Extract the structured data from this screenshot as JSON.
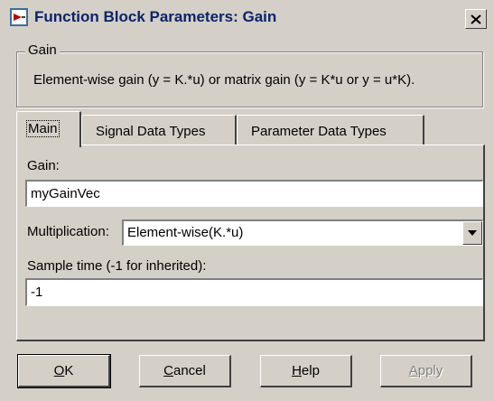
{
  "window": {
    "title": "Function Block Parameters: Gain",
    "close_glyph": "✕"
  },
  "group": {
    "legend": "Gain",
    "description": "Element-wise gain (y = K.*u) or matrix gain (y = K*u or y = u*K)."
  },
  "tabs": [
    {
      "label": "Main",
      "active": true
    },
    {
      "label": "Signal Data Types",
      "active": false
    },
    {
      "label": "Parameter Data Types",
      "active": false
    }
  ],
  "main": {
    "gain_label": "Gain:",
    "gain_value": "myGainVec",
    "multiplication_label": "Multiplication:",
    "multiplication_value": "Element-wise(K.*u)",
    "sample_time_label": "Sample time (-1 for inherited):",
    "sample_time_value": "-1"
  },
  "buttons": {
    "ok_accel": "O",
    "ok_rest": "K",
    "cancel_accel": "C",
    "cancel_rest": "ancel",
    "help_accel": "H",
    "help_rest": "elp",
    "apply_accel": "A",
    "apply_rest": "pply"
  },
  "icons": {
    "app": "simulink-block-icon",
    "close": "close-icon",
    "dropdown": "chevron-down-icon"
  }
}
